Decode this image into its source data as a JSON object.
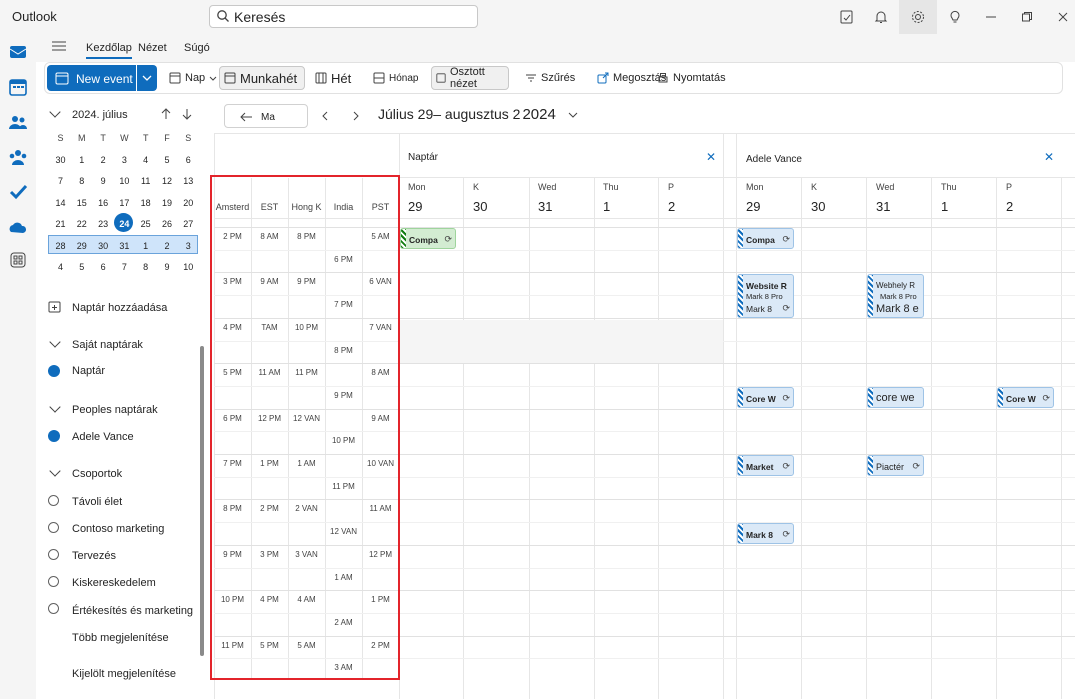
{
  "app": {
    "title": "Outlook"
  },
  "search": {
    "placeholder": "Keresés"
  },
  "ribbon_tabs": [
    "Kezdőlap",
    "Nézet",
    "Súgó"
  ],
  "ribbon": {
    "new_event": "New event",
    "day": "Nap",
    "work_week": "Munkahét",
    "week": "Hét",
    "month": "Hónap",
    "split_view": "Osztott nézet",
    "filter": "Szűrés",
    "share": "Megosztás",
    "print": "Nyomtatás"
  },
  "mini_calendar": {
    "title": "2024. július",
    "weekdays": [
      "S",
      "M",
      "T",
      "W",
      "T",
      "F",
      "S"
    ],
    "weeks": [
      [
        "30",
        "1",
        "2",
        "3",
        "4",
        "5",
        "6"
      ],
      [
        "7",
        "8",
        "9",
        "10",
        "11",
        "12",
        "13"
      ],
      [
        "14",
        "15",
        "16",
        "17",
        "18",
        "19",
        "20"
      ],
      [
        "21",
        "22",
        "23",
        "24",
        "25",
        "26",
        "27"
      ],
      [
        "28",
        "29",
        "30",
        "31",
        "1",
        "2",
        "3"
      ],
      [
        "4",
        "5",
        "6",
        "7",
        "8",
        "9",
        "10"
      ]
    ],
    "today": "24"
  },
  "left_pane": {
    "add_calendar": "Naptár hozzáadása",
    "my_calendars": "Saját naptárak",
    "my_calendar_item": "Naptár",
    "people_calendars": "Peoples naptárak",
    "people_item": "Adele Vance",
    "groups": "Csoportok",
    "group_items": [
      "Távoli élet",
      "Contoso marketing",
      "Tervezés",
      "Kiskereskedelem",
      "Értékesítés és marketing"
    ],
    "show_more": "Több megjelenítése",
    "show_selected": "Kijelölt megjelenítése"
  },
  "calendar_nav": {
    "today": "Ma",
    "range": "Július 29– augusztus 2",
    "year": "2024"
  },
  "timezones": {
    "headers": [
      "Amsterd",
      "EST",
      "Hong K",
      "India",
      "PST"
    ],
    "rows": [
      [
        "2 PM",
        "8 AM",
        "8 PM",
        "",
        "5 AM"
      ],
      [
        "",
        "",
        "",
        "6 PM",
        ""
      ],
      [
        "3 PM",
        "9 AM",
        "9 PM",
        "",
        "6 VAN"
      ],
      [
        "",
        "",
        "",
        "7 PM",
        ""
      ],
      [
        "4 PM",
        "TAM",
        "10 PM",
        "",
        "7 VAN"
      ],
      [
        "",
        "",
        "",
        "8 PM",
        ""
      ],
      [
        "5 PM",
        "11 AM",
        "11 PM",
        "",
        "8 AM"
      ],
      [
        "",
        "",
        "",
        "9 PM",
        ""
      ],
      [
        "6 PM",
        "12 PM",
        "12 VAN",
        "",
        "9 AM"
      ],
      [
        "",
        "",
        "",
        "10 PM",
        ""
      ],
      [
        "7 PM",
        "1 PM",
        "1 AM",
        "",
        "10 VAN"
      ],
      [
        "",
        "",
        "",
        "11 PM",
        ""
      ],
      [
        "8 PM",
        "2 PM",
        "2 VAN",
        "",
        "11 AM"
      ],
      [
        "",
        "",
        "",
        "12 VAN",
        ""
      ],
      [
        "9 PM",
        "3 PM",
        "3 VAN",
        "",
        "12 PM"
      ],
      [
        "",
        "",
        "",
        "1 AM",
        ""
      ],
      [
        "10 PM",
        "4 PM",
        "4 AM",
        "",
        "1 PM"
      ],
      [
        "",
        "",
        "",
        "2 AM",
        ""
      ],
      [
        "11 PM",
        "5 PM",
        "5 AM",
        "",
        "2 PM"
      ],
      [
        "",
        "",
        "",
        "3 AM",
        ""
      ]
    ]
  },
  "calendars": [
    {
      "title": "Naptár",
      "days": [
        {
          "name": "Mon",
          "num": "29"
        },
        {
          "name": "K",
          "num": "30"
        },
        {
          "name": "Wed",
          "num": "31"
        },
        {
          "name": "Thu",
          "num": "1"
        },
        {
          "name": "P",
          "num": "2"
        }
      ]
    },
    {
      "title": "Adele Vance",
      "days": [
        {
          "name": "Mon",
          "num": "29"
        },
        {
          "name": "K",
          "num": "30"
        },
        {
          "name": "Wed",
          "num": "31"
        },
        {
          "name": "Thu",
          "num": "1"
        },
        {
          "name": "P",
          "num": "2"
        }
      ]
    }
  ],
  "events": {
    "naptar_compa": "Compa",
    "adele_compa": "Compa",
    "website": "Website R",
    "website_sub1": "Mark 8 Pro",
    "website_sub2": "Mark 8",
    "webhely": "Webhely R",
    "webhely_sub1": "Mark 8 Pro",
    "webhely_sub2": "Mark 8 e",
    "core_mon": "Core W",
    "core_wed": "core we",
    "core_fri": "Core W",
    "market": "Market",
    "piacter": "Piactér",
    "mark8": "Mark 8"
  },
  "colors": {
    "accent": "#0f6cbd",
    "highlight": "#e3242b"
  }
}
